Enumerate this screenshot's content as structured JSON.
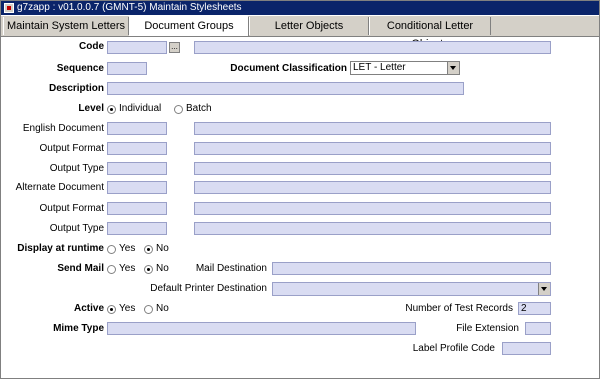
{
  "window": {
    "title": "g7zapp : v01.0.0.7 (GMNT-5) Maintain Stylesheets"
  },
  "tabs": [
    {
      "label": "Maintain System Letters"
    },
    {
      "label": "Document Groups"
    },
    {
      "label": "Letter Objects"
    },
    {
      "label": "Conditional Letter Objects"
    }
  ],
  "form": {
    "code_label": "Code",
    "sequence_label": "Sequence",
    "doc_class_label": "Document Classification",
    "doc_class_value": "LET - Letter",
    "description_label": "Description",
    "level_label": "Level",
    "level_opt1": "Individual",
    "level_opt2": "Batch",
    "english_doc_label": "English Document",
    "output_format_label": "Output Format",
    "output_type_label": "Output Type",
    "alternate_doc_label": "Alternate Document",
    "output_format2_label": "Output Format",
    "output_type2_label": "Output Type",
    "display_runtime_label": "Display at runtime",
    "yes": "Yes",
    "no": "No",
    "send_mail_label": "Send Mail",
    "mail_dest_label": "Mail Destination",
    "default_printer_label": "Default Printer Destination",
    "active_label": "Active",
    "test_records_label": "Number of Test Records",
    "test_records_value": "2",
    "mime_type_label": "Mime Type",
    "file_ext_label": "File Extension",
    "label_profile_label": "Label Profile Code"
  }
}
